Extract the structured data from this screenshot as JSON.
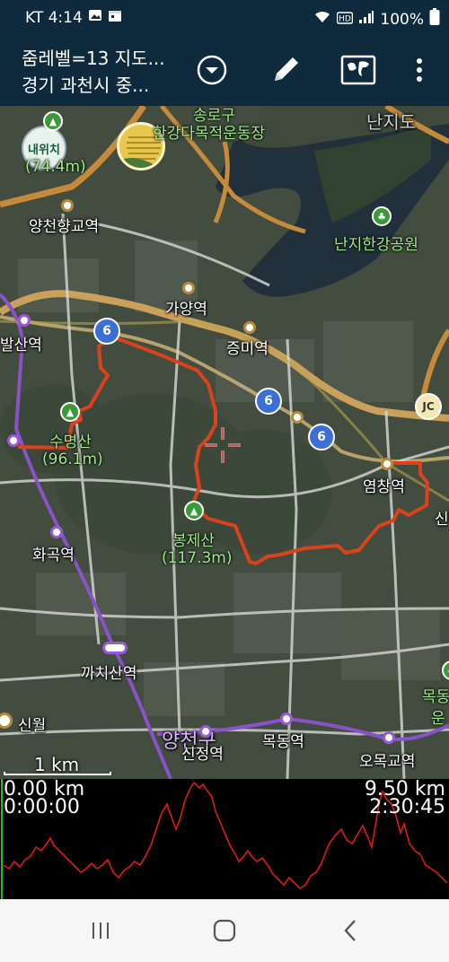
{
  "status": {
    "carrier_time": "KT 4:14",
    "battery": "100%"
  },
  "appbar": {
    "title_line1": "줌레벨=13 지도...",
    "title_line2": "경기 과천시 중..."
  },
  "map": {
    "my_location_label": "내위치",
    "labels": {
      "songdo": "송로구",
      "hangang_mokjeok": "한강다목적운동장",
      "nanjido": "난지도",
      "elev_74": "(74.4m)",
      "yangcheon": "양천향교역",
      "nanji_park": "난지한강공원",
      "gayang": "가양역",
      "balsan": "발산역",
      "jeungmi": "증미역",
      "susan": "수명산",
      "elev_96": "(96.1m)",
      "yeomchang": "염창역",
      "bongje": "봉제산",
      "elev_117": "(117.3m)",
      "hwagok": "화곡역",
      "kkachisan": "까치산역",
      "mok": "목동",
      "un": "운",
      "sinwol": "신월",
      "yangcheon_gu": "양천구",
      "sinjeong": "신정역",
      "mokdong": "목동역",
      "omokgyo": "오목교역",
      "sin": "신"
    },
    "highway_num": "6",
    "jc_label": "JC",
    "scale": "1 km"
  },
  "profile": {
    "start_distance": "0.00 km",
    "start_time": "0:00:00",
    "end_distance": "9.50 km",
    "end_time": "2:30:45"
  },
  "colors": {
    "header_bg": "#0f2a3d",
    "route": "#d9421a",
    "profile_line": "#e01818"
  }
}
